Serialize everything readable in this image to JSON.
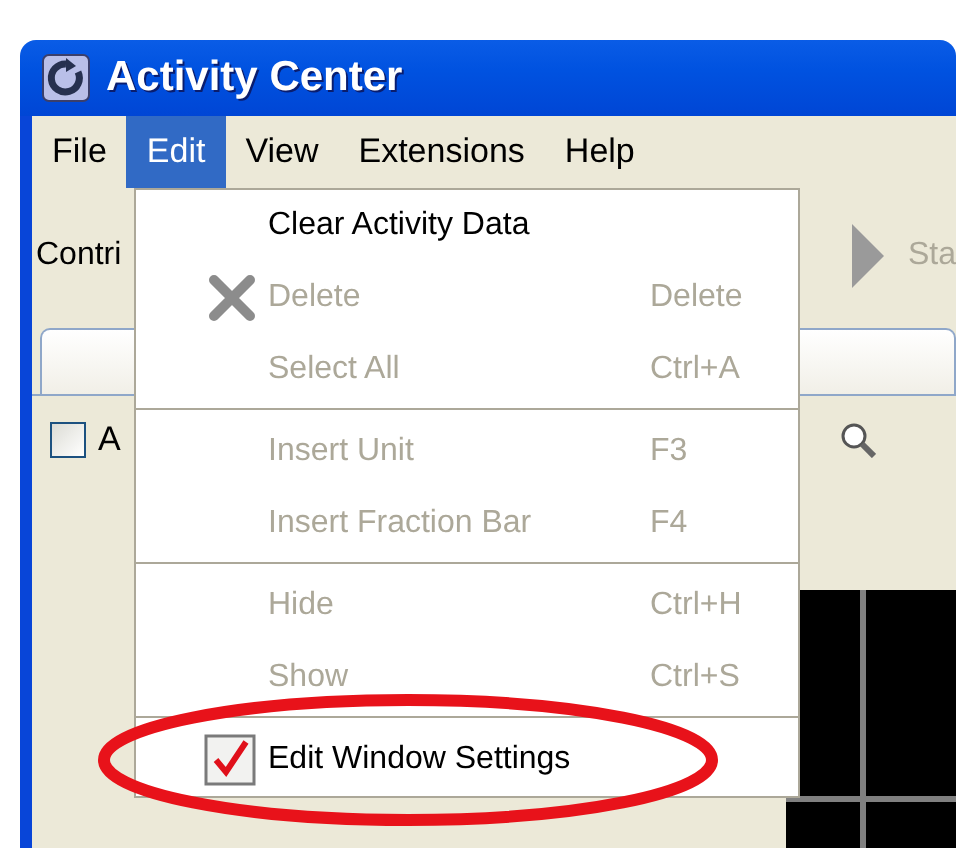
{
  "window": {
    "title": "Activity Center"
  },
  "menu_bar": [
    {
      "label": "File",
      "selected": false
    },
    {
      "label": "Edit",
      "selected": true
    },
    {
      "label": "View",
      "selected": false
    },
    {
      "label": "Extensions",
      "selected": false
    },
    {
      "label": "Help",
      "selected": false
    }
  ],
  "toolbar": {
    "label": "Contri",
    "button_label": "Sta"
  },
  "option": {
    "label": "A",
    "checked": false
  },
  "edit_menu": {
    "items": [
      {
        "kind": "plain",
        "label": "Clear Activity Data",
        "disabled": false
      },
      {
        "kind": "icon",
        "label": "Delete",
        "shortcut": "Delete",
        "disabled": true
      },
      {
        "kind": "plain",
        "label": "Select All",
        "shortcut": "Ctrl+A",
        "disabled": true
      },
      {
        "kind": "separator"
      },
      {
        "kind": "plain",
        "label": "Insert Unit",
        "shortcut": "F3",
        "disabled": true
      },
      {
        "kind": "plain",
        "label": "Insert Fraction Bar",
        "shortcut": "F4",
        "disabled": true
      },
      {
        "kind": "separator"
      },
      {
        "kind": "plain",
        "label": "Hide",
        "shortcut": "Ctrl+H",
        "disabled": true
      },
      {
        "kind": "plain",
        "label": "Show",
        "shortcut": "Ctrl+S",
        "disabled": true
      },
      {
        "kind": "separator"
      },
      {
        "kind": "check",
        "label": "Edit Window Settings",
        "checked": true,
        "disabled": false
      }
    ]
  }
}
